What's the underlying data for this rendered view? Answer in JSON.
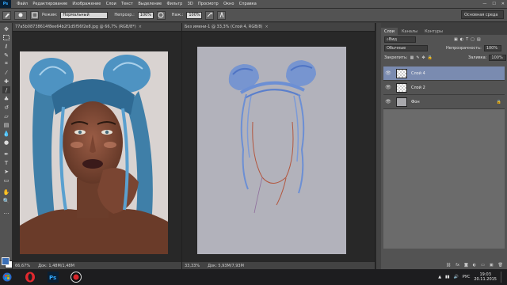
{
  "menubar": {
    "logo": "Ps",
    "items": [
      "Файл",
      "Редактирование",
      "Изображение",
      "Слои",
      "Текст",
      "Выделение",
      "Фильтр",
      "3D",
      "Просмотр",
      "Окно",
      "Справка"
    ],
    "controls": [
      "—",
      "☐",
      "✕"
    ]
  },
  "options": {
    "mode_label": "Режим:",
    "mode_value": "Нормальный",
    "opacity_label": "Непрозр.:",
    "opacity_value": "100%",
    "flow_label": "Наж.:",
    "flow_value": "100%",
    "workspace": "Основная среда"
  },
  "doc1": {
    "tab": "77a5b08738614f8ee64b2f1d5f56f2e8.jpg @ 66,7% (RGB/8*)",
    "zoom": "66,67%",
    "status": "Док: 1,48M/1,48M"
  },
  "doc2": {
    "tab": "Без имени-1 @ 33,3% (Слой 4, RGB/8)",
    "zoom": "33,33%",
    "status": "Док: 5,93M/7,93M"
  },
  "panel": {
    "tabs": [
      "Слои",
      "Каналы",
      "Контуры"
    ],
    "filter_label": "Вид",
    "blend_mode": "Обычные",
    "opacity_label": "Непрозрачность:",
    "opacity_value": "100%",
    "lock_label": "Закрепить:",
    "fill_label": "Заливка:",
    "fill_value": "100%",
    "layers": [
      {
        "name": "Слой 4",
        "selected": true,
        "thumb": "checker"
      },
      {
        "name": "Слой 2",
        "selected": false,
        "thumb": "checker"
      },
      {
        "name": "Фон",
        "selected": false,
        "thumb": "grey"
      }
    ],
    "bottom_icons": [
      "link-icon",
      "fx-icon",
      "mask-icon",
      "adjust-icon",
      "folder-icon",
      "new-layer-icon",
      "trash-icon"
    ]
  },
  "taskbar": {
    "apps": [
      "opera-icon",
      "photoshop-icon",
      "recorder-icon"
    ],
    "lang": "РУС",
    "time": "19:03",
    "date": "20.11.2015"
  },
  "colors": {
    "foreground": "#3b6fb6",
    "background": "#ffffff",
    "selected_layer": "#7a8bb0"
  }
}
